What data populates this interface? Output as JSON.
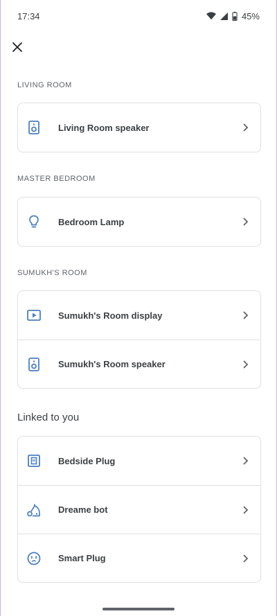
{
  "status": {
    "time": "17:34",
    "battery": "45%"
  },
  "sections": [
    {
      "title": "LIVING ROOM",
      "items": [
        {
          "label": "Living Room speaker",
          "icon": "speaker-icon"
        }
      ]
    },
    {
      "title": "MASTER BEDROOM",
      "items": [
        {
          "label": "Bedroom Lamp",
          "icon": "lightbulb-icon"
        }
      ]
    },
    {
      "title": "SUMUKH'S ROOM",
      "items": [
        {
          "label": "Sumukh's Room display",
          "icon": "display-icon"
        },
        {
          "label": "Sumukh's Room speaker",
          "icon": "speaker-icon"
        }
      ]
    }
  ],
  "linked": {
    "title": "Linked to you",
    "items": [
      {
        "label": "Bedside Plug",
        "icon": "plug-box-icon"
      },
      {
        "label": "Dreame bot",
        "icon": "vacuum-icon"
      },
      {
        "label": "Smart Plug",
        "icon": "outlet-icon"
      }
    ]
  },
  "colors": {
    "icon_blue": "#4a7fc1",
    "text": "#3c4043",
    "muted": "#5f6368",
    "border": "#e0e0e0"
  }
}
